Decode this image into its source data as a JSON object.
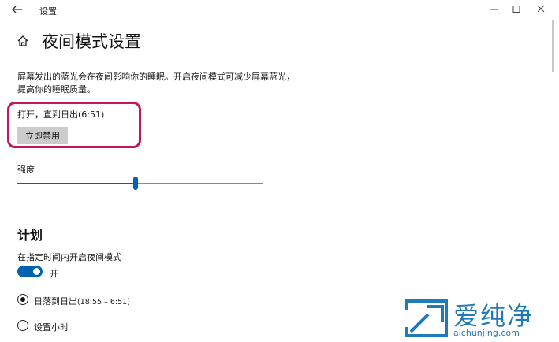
{
  "window": {
    "title": "设置",
    "controls": [
      "minimize-icon",
      "maximize-icon",
      "close-icon"
    ]
  },
  "header": {
    "title": "夜间模式设置",
    "home_icon": "home-icon",
    "back_icon": "back-arrow-icon"
  },
  "description": "屏幕发出的蓝光会在夜间影响你的睡眠。开启夜间模式可减少屏幕蓝光，提高你的睡眠质量。",
  "status": {
    "text": "打开，直到日出(6:51)",
    "button_label": "立即禁用",
    "highlight_color": "#c2185b"
  },
  "strength": {
    "label": "强度",
    "value_fraction": 0.48
  },
  "schedule": {
    "section_title": "计划",
    "toggle_label": "在指定时间内开启夜间模式",
    "toggle_state": "开",
    "toggle_on": true,
    "options": [
      {
        "label": "日落到日出",
        "detail": "(18:55 – 6:51)",
        "selected": true
      },
      {
        "label": "设置小时",
        "detail": "",
        "selected": false
      }
    ]
  },
  "watermark": {
    "title": "爱纯净",
    "url": "aichunjing.com",
    "color": "#1f7ab8"
  },
  "colors": {
    "accent": "#0063b1",
    "button_bg": "#cccccc"
  }
}
